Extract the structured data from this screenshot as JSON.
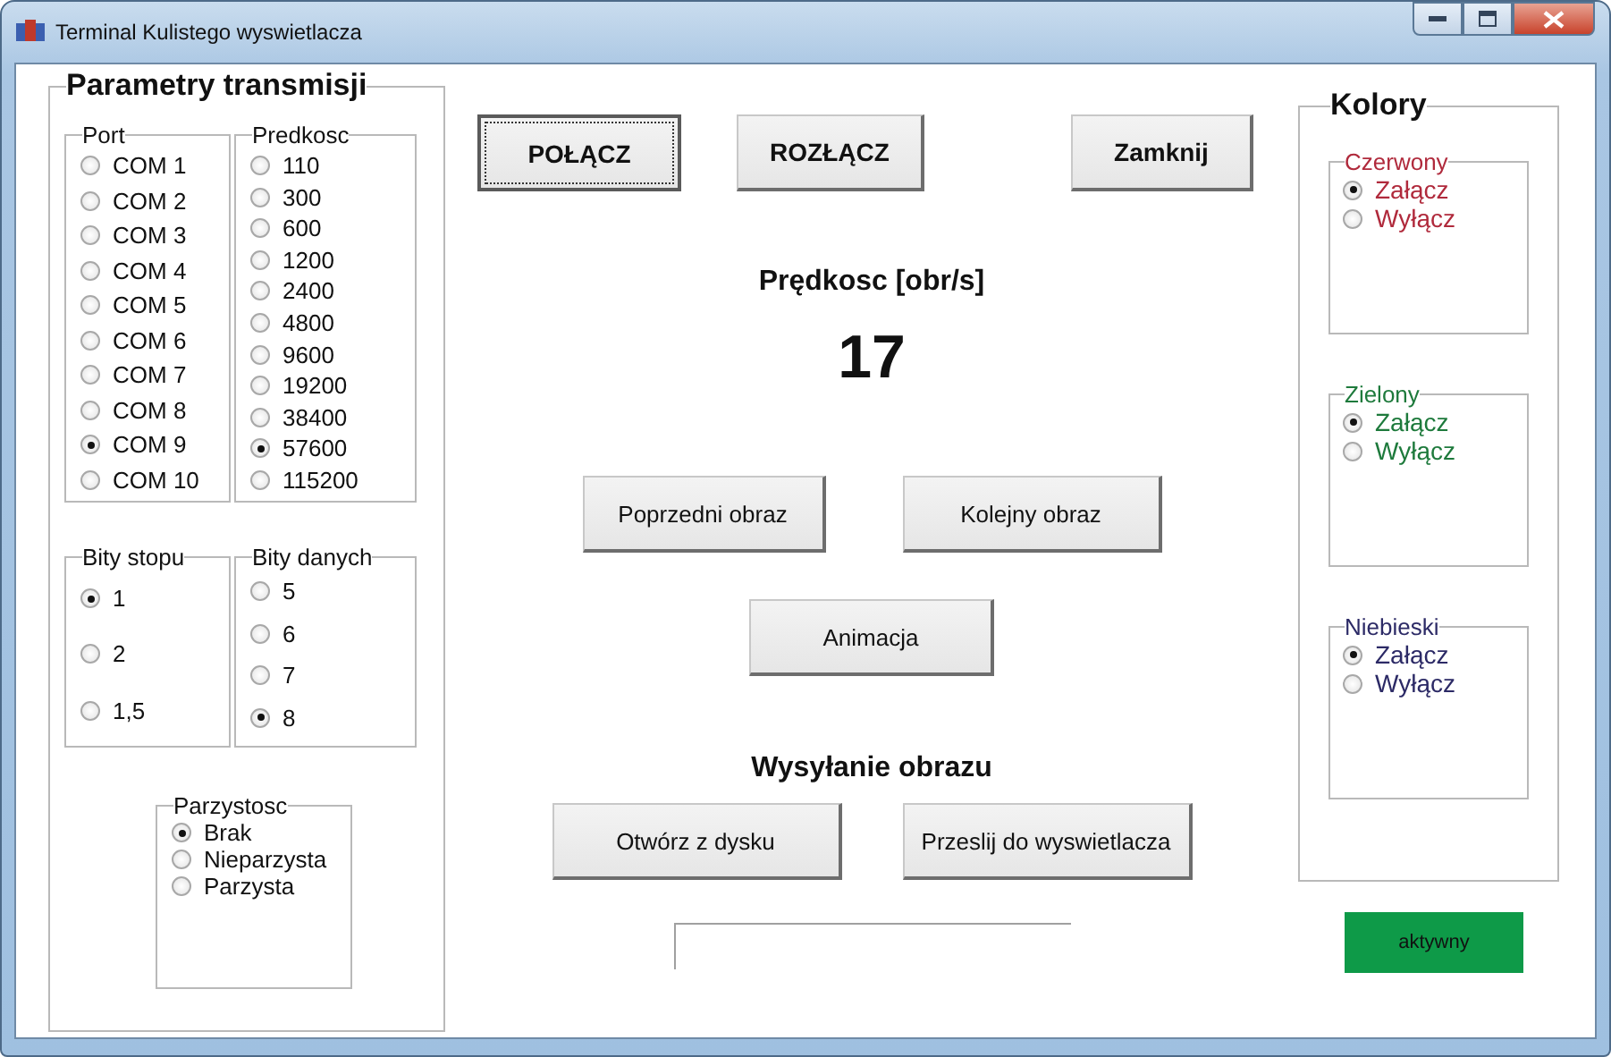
{
  "window": {
    "title": "Terminal Kulistego wyswietlacza"
  },
  "transmission": {
    "title": "Parametry transmisji",
    "groups": [
      {
        "title": "Port",
        "options": [
          {
            "label": "COM 1",
            "selected": false
          },
          {
            "label": "COM 2",
            "selected": false
          },
          {
            "label": "COM 3",
            "selected": false
          },
          {
            "label": "COM 4",
            "selected": false
          },
          {
            "label": "COM 5",
            "selected": false
          },
          {
            "label": "COM 6",
            "selected": false
          },
          {
            "label": "COM 7",
            "selected": false
          },
          {
            "label": "COM 8",
            "selected": false
          },
          {
            "label": "COM 9",
            "selected": true
          },
          {
            "label": "COM 10",
            "selected": false
          }
        ]
      },
      {
        "title": "Predkosc",
        "options": [
          {
            "label": "110",
            "selected": false
          },
          {
            "label": "300",
            "selected": false
          },
          {
            "label": "600",
            "selected": false
          },
          {
            "label": "1200",
            "selected": false
          },
          {
            "label": "2400",
            "selected": false
          },
          {
            "label": "4800",
            "selected": false
          },
          {
            "label": "9600",
            "selected": false
          },
          {
            "label": "19200",
            "selected": false
          },
          {
            "label": "38400",
            "selected": false
          },
          {
            "label": "57600",
            "selected": true
          },
          {
            "label": "115200",
            "selected": false
          }
        ]
      },
      {
        "title": "Bity stopu",
        "options": [
          {
            "label": "1",
            "selected": true
          },
          {
            "label": "2",
            "selected": false
          },
          {
            "label": "1,5",
            "selected": false
          }
        ]
      },
      {
        "title": "Bity danych",
        "options": [
          {
            "label": "5",
            "selected": false
          },
          {
            "label": "6",
            "selected": false
          },
          {
            "label": "7",
            "selected": false
          },
          {
            "label": "8",
            "selected": true
          }
        ]
      },
      {
        "title": "Parzystosc",
        "options": [
          {
            "label": "Brak",
            "selected": true
          },
          {
            "label": "Nieparzysta",
            "selected": false
          },
          {
            "label": "Parzysta",
            "selected": false
          }
        ]
      }
    ]
  },
  "top_buttons": [
    {
      "label": "POŁĄCZ",
      "focused": true
    },
    {
      "label": "ROZŁĄCZ",
      "focused": false
    },
    {
      "label": "Zamknij",
      "focused": false
    }
  ],
  "speed": {
    "label": "Prędkosc [obr/s]",
    "value": "17"
  },
  "image_buttons": [
    "Poprzedni obraz",
    "Kolejny obraz"
  ],
  "animation_button": "Animacja",
  "send": {
    "title": "Wysyłanie obrazu",
    "buttons": [
      "Otwórz z dysku",
      "Przeslij do wyswietlacza"
    ]
  },
  "colors": {
    "title": "Kolory",
    "channels": [
      {
        "name": "Czerwony",
        "color": "#b02a3c",
        "options": [
          {
            "label": "Załącz",
            "selected": true
          },
          {
            "label": "Wyłącz",
            "selected": false
          }
        ]
      },
      {
        "name": "Zielony",
        "color": "#1e7a3c",
        "options": [
          {
            "label": "Załącz",
            "selected": true
          },
          {
            "label": "Wyłącz",
            "selected": false
          }
        ]
      },
      {
        "name": "Niebieski",
        "color": "#2c2a66",
        "options": [
          {
            "label": "Załącz",
            "selected": true
          },
          {
            "label": "Wyłącz",
            "selected": false
          }
        ]
      }
    ]
  },
  "status": {
    "label": "aktywny",
    "color": "#0e9a48"
  }
}
